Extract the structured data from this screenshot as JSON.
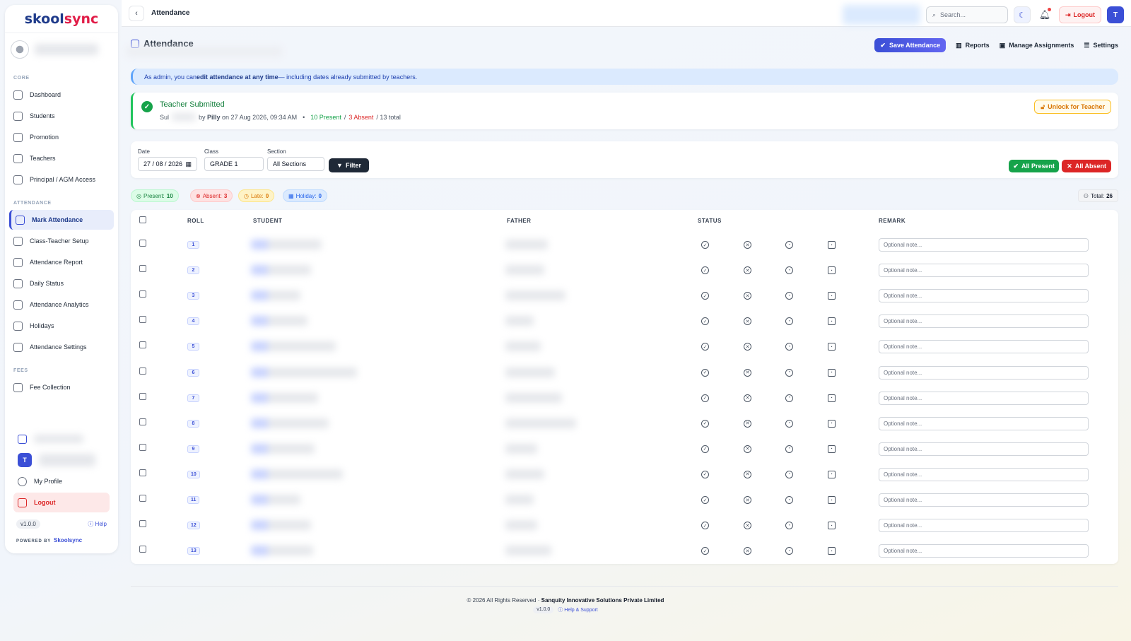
{
  "app": {
    "logo_main": "skool",
    "logo_accent": "sync"
  },
  "sidebar": {
    "sections": [
      {
        "title": "CORE",
        "items": [
          {
            "label": "Dashboard",
            "icon": "dashboard-icon"
          },
          {
            "label": "Students",
            "icon": "graduation-cap-icon"
          },
          {
            "label": "Promotion",
            "icon": "arrow-up-circle-icon"
          },
          {
            "label": "Teachers",
            "icon": "id-card-icon"
          },
          {
            "label": "Principal / AGM Access",
            "icon": "sliders-icon"
          }
        ]
      },
      {
        "title": "ATTENDANCE",
        "items": [
          {
            "label": "Mark Attendance",
            "icon": "calendar-check-icon",
            "active": true
          },
          {
            "label": "Class-Teacher Setup",
            "icon": "badge-icon"
          },
          {
            "label": "Attendance Report",
            "icon": "line-chart-icon"
          },
          {
            "label": "Daily Status",
            "icon": "calendar-check-icon"
          },
          {
            "label": "Attendance Analytics",
            "icon": "trend-chart-icon"
          },
          {
            "label": "Holidays",
            "icon": "calendar-icon"
          },
          {
            "label": "Attendance Settings",
            "icon": "sliders-icon"
          }
        ]
      },
      {
        "title": "FEES",
        "items": [
          {
            "label": "Fee Collection",
            "icon": "receipt-icon"
          }
        ]
      }
    ],
    "footer": {
      "avatar_initial": "T",
      "my_profile": "My Profile",
      "logout": "Logout",
      "version": "v1.0.0",
      "help": "Help",
      "powered_by": "POWERED BY",
      "powered_brand": "Skoolsync"
    }
  },
  "topbar": {
    "breadcrumb": "Attendance",
    "search_placeholder": "Search...",
    "logout": "Logout",
    "avatar_initial": "T"
  },
  "page": {
    "title": "Attendance",
    "actions": {
      "save": "Save Attendance",
      "reports": "Reports",
      "manage": "Manage Assignments",
      "settings": "Settings"
    }
  },
  "banner": {
    "prefix": "As admin, you can ",
    "bold": "edit attendance at any time",
    "suffix": " — including dates already submitted by teachers."
  },
  "submitted": {
    "title": "Teacher Submitted",
    "prefix": "Sul",
    "by": "by ",
    "teacher": "Pilly",
    "on": " on 27 Aug 2026, 09:34 AM",
    "bullet": "•",
    "present": "10 Present",
    "absent": "3 Absent",
    "total": "/ 13 total",
    "slash": "/",
    "unlock": "Unlock for Teacher"
  },
  "filters": {
    "date_label": "Date",
    "date_value": "27 / 08 / 2026",
    "class_label": "Class",
    "class_value": "GRADE 1",
    "section_label": "Section",
    "section_value": "All Sections",
    "filter_btn": "Filter",
    "all_present": "All Present",
    "all_absent": "All Absent"
  },
  "stats": {
    "present_label": "Present:",
    "present": "10",
    "absent_label": "Absent:",
    "absent": "3",
    "late_label": "Late:",
    "late": "0",
    "holiday_label": "Holiday:",
    "holiday": "0",
    "total_label": "Total:",
    "total": "26"
  },
  "table": {
    "headers": {
      "roll": "ROLL",
      "student": "STUDENT",
      "father": "FATHER",
      "status": "STATUS",
      "remark": "REMARK"
    },
    "remark_placeholder": "Optional note...",
    "rows": [
      {
        "roll": "1"
      },
      {
        "roll": "2"
      },
      {
        "roll": "3"
      },
      {
        "roll": "4"
      },
      {
        "roll": "5"
      },
      {
        "roll": "6"
      },
      {
        "roll": "7"
      },
      {
        "roll": "8"
      },
      {
        "roll": "9"
      },
      {
        "roll": "10"
      },
      {
        "roll": "11"
      },
      {
        "roll": "12"
      },
      {
        "roll": "13"
      }
    ]
  },
  "footer": {
    "copyright": "© 2026 All Rights Reserved ·",
    "company": "Sanquity Innovative Solutions Private Limited",
    "version": "v1.0.0",
    "help": "Help & Support"
  }
}
